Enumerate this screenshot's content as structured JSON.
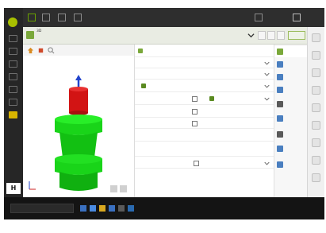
{
  "app": {
    "title": "3D",
    "subtitle": "",
    "search_placeholder": ""
  },
  "colors": {
    "part_body": "#19d419",
    "part_top": "#d21414",
    "axis": "#2244cc",
    "accent_green": "#7aa83a",
    "rail_active": "#d8b400",
    "power": "#a8c000"
  },
  "right_tabs": [
    {
      "label": "",
      "icon": "document-icon"
    },
    {
      "label": "",
      "icon": "tool-icon"
    },
    {
      "label": "",
      "icon": "tool-icon"
    },
    {
      "label": "",
      "icon": "machine-icon"
    },
    {
      "label": "",
      "icon": "settings-icon"
    },
    {
      "label": "",
      "icon": "grid-icon"
    },
    {
      "label": "",
      "icon": "user-icon"
    },
    {
      "label": "",
      "icon": "people-icon"
    },
    {
      "label": "",
      "icon": "list-icon"
    }
  ]
}
